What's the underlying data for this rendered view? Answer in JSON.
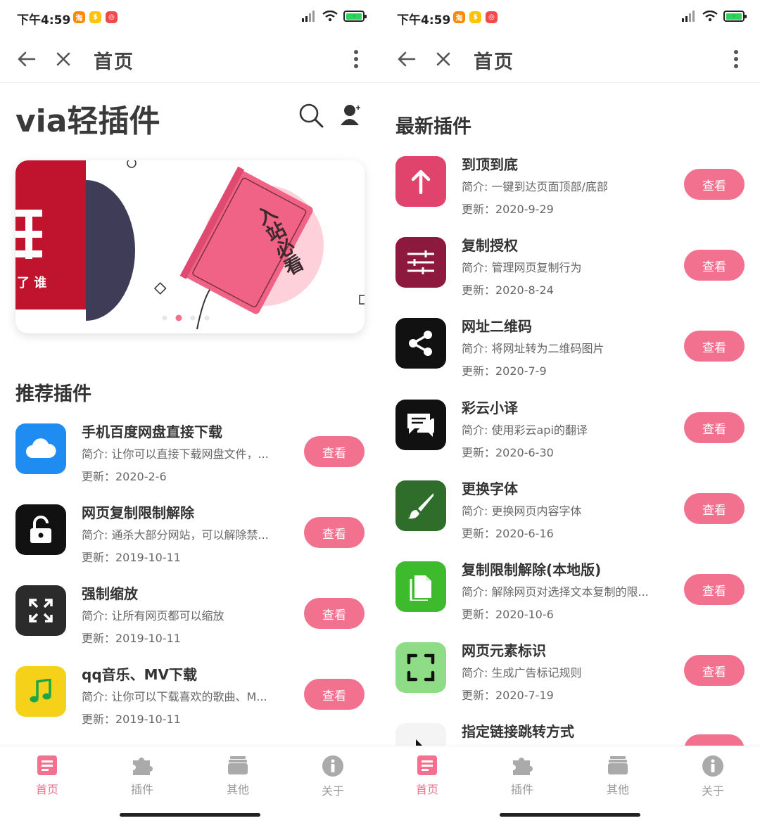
{
  "status": {
    "time": "下午4:59"
  },
  "topbar": {
    "title": "首页"
  },
  "left": {
    "brand_title": "via轻插件",
    "banner": {
      "book_text": "入站必看",
      "left_text": "了 谁"
    },
    "section_title": "推荐插件",
    "items": [
      {
        "name": "手机百度网盘直接下载",
        "desc": "简介: 让你可以直接下载网盘文件，...",
        "date": "更新：2020-2-6",
        "btn": "查看",
        "icon": "cloud-icon",
        "color": "#1e8cf0"
      },
      {
        "name": "网页复制限制解除",
        "desc": "简介: 通杀大部分网站，可以解除禁...",
        "date": "更新：2019-10-11",
        "btn": "查看",
        "icon": "unlock-icon",
        "color": "#111111"
      },
      {
        "name": "强制缩放",
        "desc": "简介: 让所有网页都可以缩放",
        "date": "更新：2019-10-11",
        "btn": "查看",
        "icon": "expand-icon",
        "color": "#2b2b2b"
      },
      {
        "name": "qq音乐、MV下载",
        "desc": "简介: 让你可以下载喜欢的歌曲、M...",
        "date": "更新：2019-10-11",
        "btn": "查看",
        "icon": "music-note-icon",
        "color": "#f5d11a"
      }
    ]
  },
  "right": {
    "section_title": "最新插件",
    "items": [
      {
        "name": "到顶到底",
        "desc": "简介: 一键到达页面顶部/底部",
        "date": "更新：2020-9-29",
        "btn": "查看",
        "icon": "arrow-up-icon",
        "color": "#e0436b"
      },
      {
        "name": "复制授权",
        "desc": "简介: 管理网页复制行为",
        "date": "更新：2020-8-24",
        "btn": "查看",
        "icon": "sliders-icon",
        "color": "#8d1a3e"
      },
      {
        "name": "网址二维码",
        "desc": "简介: 将网址转为二维码图片",
        "date": "更新：2020-7-9",
        "btn": "查看",
        "icon": "share-icon",
        "color": "#111111"
      },
      {
        "name": "彩云小译",
        "desc": "简介: 使用彩云api的翻译",
        "date": "更新：2020-6-30",
        "btn": "查看",
        "icon": "chat-icon",
        "color": "#111111"
      },
      {
        "name": "更换字体",
        "desc": "简介: 更换网页内容字体",
        "date": "更新：2020-6-16",
        "btn": "查看",
        "icon": "brush-icon",
        "color": "#2e6e2a"
      },
      {
        "name": "复制限制解除(本地版)",
        "desc": "简介: 解除网页对选择文本复制的限...",
        "date": "更新：2020-10-6",
        "btn": "查看",
        "icon": "document-icon",
        "color": "#3dbb2d"
      },
      {
        "name": "网页元素标识",
        "desc": "简介: 生成广告标记规则",
        "date": "更新：2020-7-19",
        "btn": "查看",
        "icon": "scan-frame-icon",
        "color": "#8edc86"
      },
      {
        "name": "指定链接跳转方式",
        "desc": "",
        "date": "",
        "btn": "",
        "icon": "cursor-icon",
        "color": "#f4f4f4"
      }
    ]
  },
  "nav": [
    {
      "label": "首页",
      "icon": "home-doc-icon"
    },
    {
      "label": "插件",
      "icon": "puzzle-icon"
    },
    {
      "label": "其他",
      "icon": "box-icon"
    },
    {
      "label": "关于",
      "icon": "info-icon"
    }
  ],
  "colors": {
    "accent": "#f2718f",
    "text": "#333333",
    "muted": "#999999"
  }
}
